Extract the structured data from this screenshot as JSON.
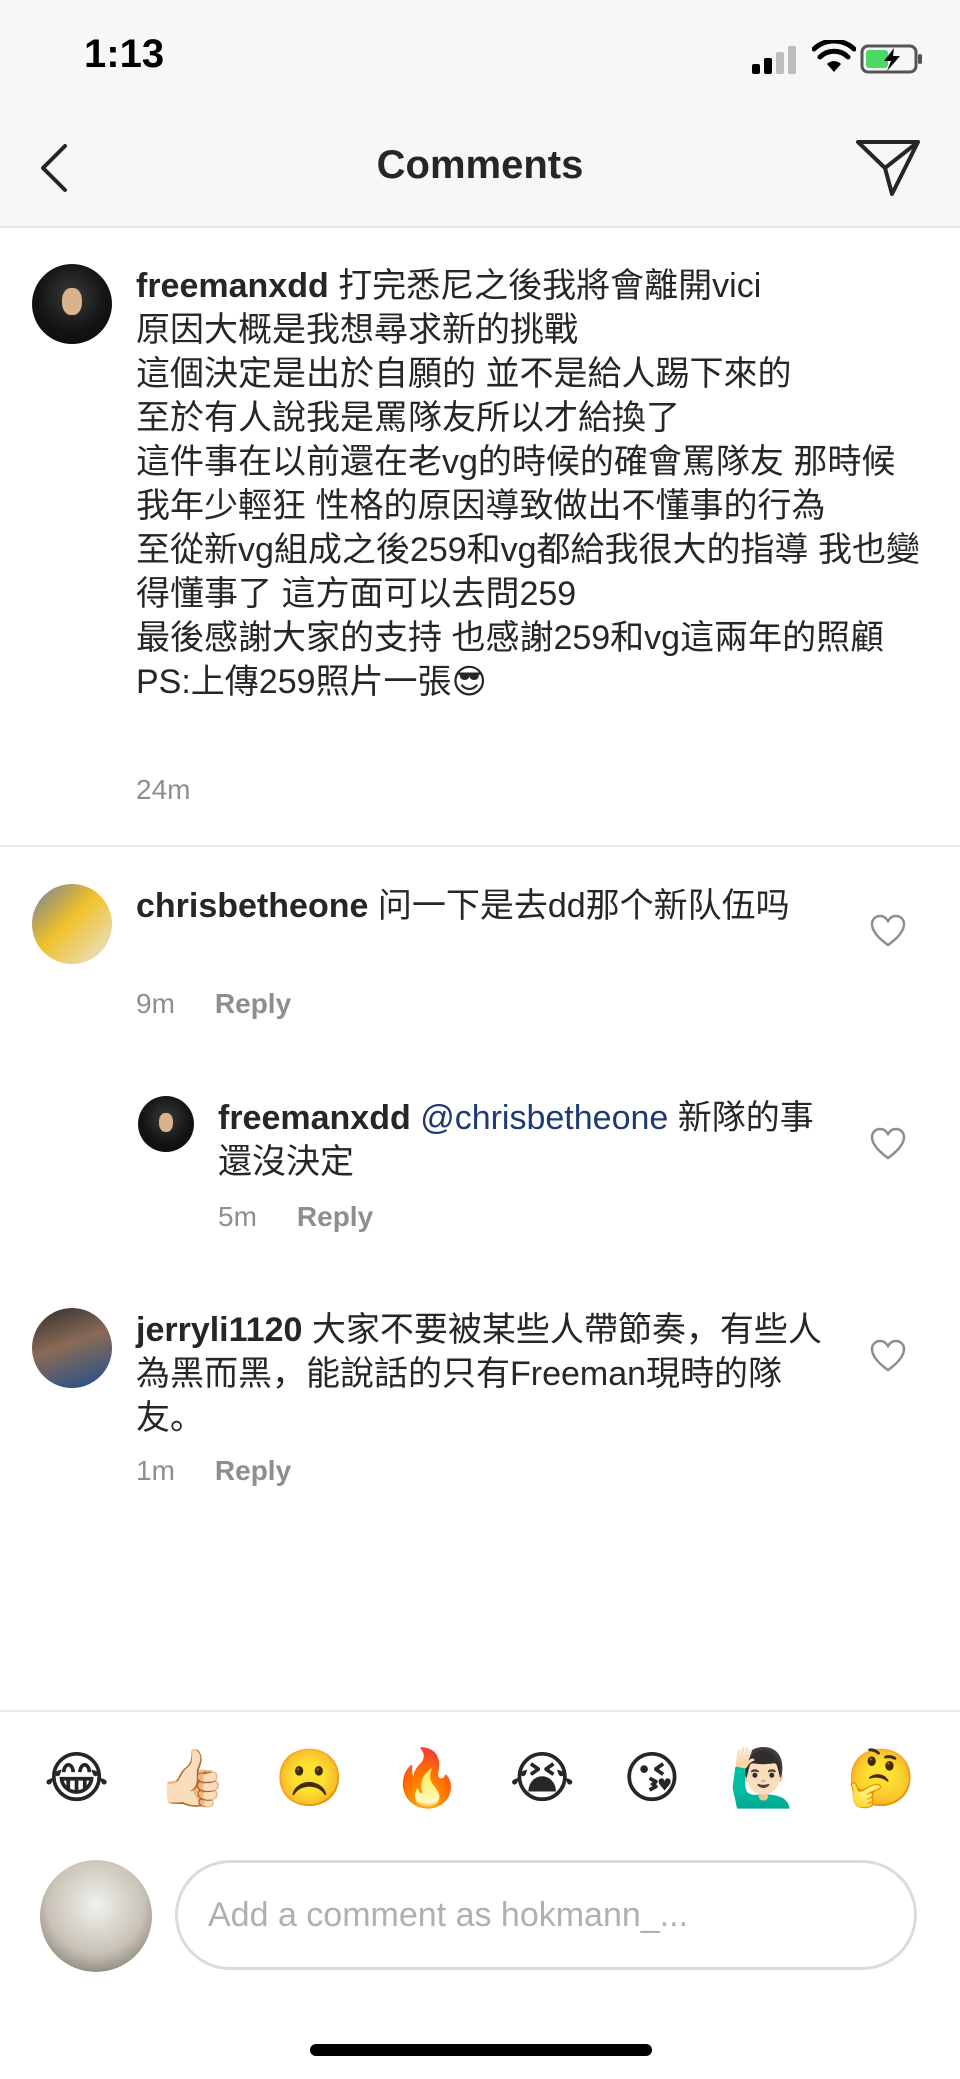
{
  "status_bar": {
    "time": "1:13"
  },
  "nav": {
    "title": "Comments"
  },
  "caption": {
    "username": "freemanxdd",
    "text": "打完悉尼之後我將會離開vici\n原因大概是我想尋求新的挑戰\n這個決定是出於自願的 並不是給人踢下來的\n至於有人說我是罵隊友所以才給換了\n這件事在以前還在老vg的時候的確會罵隊友 那時候我年少輕狂 性格的原因導致做出不懂事的行為\n至從新vg組成之後259和vg都給我很大的指導 我也變得懂事了 這方面可以去問259\n最後感謝大家的支持 也感謝259和vg這兩年的照顧\nPS:上傳259照片一張😎",
    "time": "24m"
  },
  "comments": [
    {
      "username": "chrisbetheone",
      "text": "问一下是去dd那个新队伍吗",
      "time": "9m",
      "reply_label": "Reply"
    },
    {
      "username": "freemanxdd",
      "mention": "@chrisbetheone",
      "text": "新隊的事還沒決定",
      "time": "5m",
      "reply_label": "Reply"
    },
    {
      "username": "jerryli1120",
      "text": "大家不要被某些人帶節奏，有些人為黑而黑，能說話的只有Freeman現時的隊友。",
      "time": "1m",
      "reply_label": "Reply"
    }
  ],
  "emoji_bar": [
    "😂",
    "👍🏻",
    "☹️",
    "🔥",
    "😭",
    "😘",
    "🙋🏻‍♂️",
    "🤔"
  ],
  "input": {
    "placeholder": "Add a comment as hokmann_..."
  },
  "icons": {
    "back": "chevron-left-icon",
    "send": "paper-plane-icon",
    "like": "heart-outline-icon"
  }
}
